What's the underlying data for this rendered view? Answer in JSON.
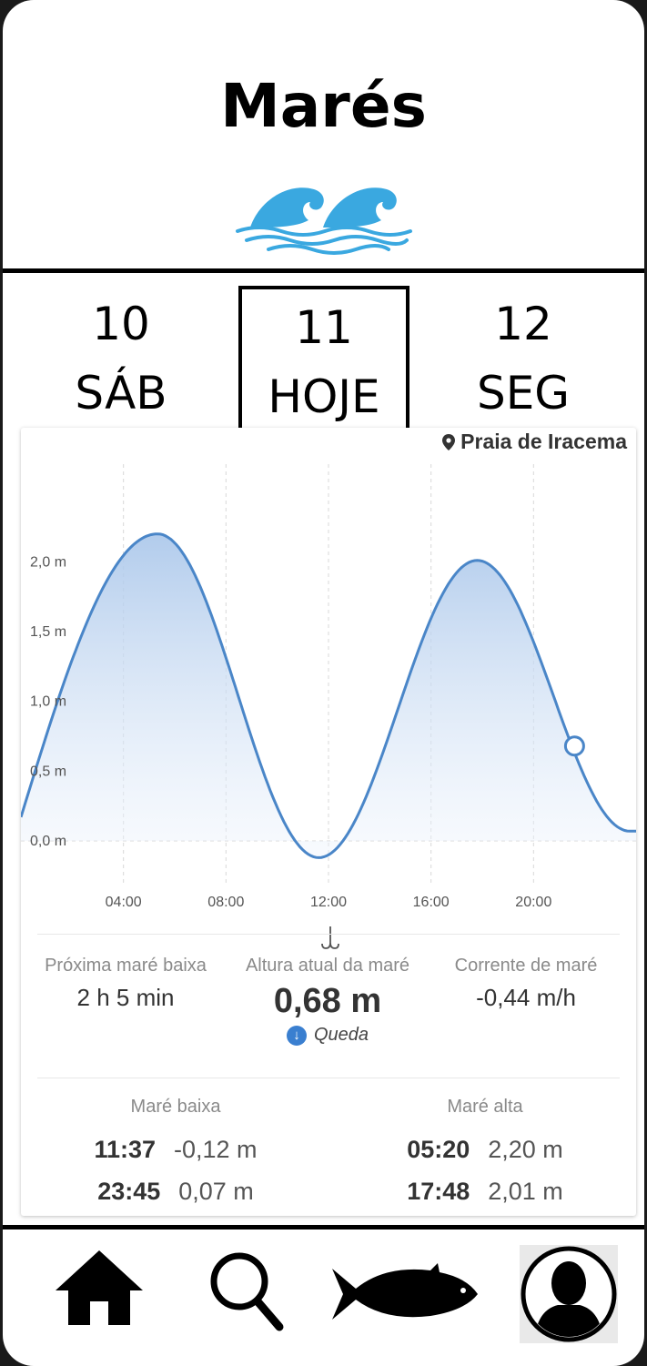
{
  "header": {
    "title": "Marés",
    "logo_icon": "waves-icon"
  },
  "days": [
    {
      "num": "10",
      "label": "SÁB",
      "selected": false
    },
    {
      "num": "11",
      "label": "HOJE",
      "selected": true
    },
    {
      "num": "12",
      "label": "SEG",
      "selected": false
    }
  ],
  "location": {
    "name": "Praia de Iracema",
    "icon": "map-pin-icon"
  },
  "chart_data": {
    "type": "area",
    "y_ticks": [
      "2,0 m",
      "1,5 m",
      "1,0 m",
      "0,5 m",
      "0,0 m"
    ],
    "y_tick_values": [
      2.0,
      1.5,
      1.0,
      0.5,
      0.0
    ],
    "x_ticks": [
      "04:00",
      "08:00",
      "12:00",
      "16:00",
      "20:00"
    ],
    "x_tick_values": [
      4,
      8,
      12,
      16,
      20
    ],
    "xlim": [
      0,
      24
    ],
    "ylim": [
      -0.3,
      2.7
    ],
    "grid": true,
    "series": [
      {
        "points": [
          {
            "x": 0.0,
            "y": 0.17
          },
          {
            "x": 5.33,
            "y": 2.2
          },
          {
            "x": 11.62,
            "y": -0.12
          },
          {
            "x": 17.8,
            "y": 2.01
          },
          {
            "x": 23.75,
            "y": 0.07
          }
        ]
      }
    ],
    "current_marker": {
      "x": 21.6,
      "y": 0.68
    },
    "accent_color": "#4a86c8"
  },
  "stats": {
    "next_low": {
      "label": "Próxima maré baixa",
      "value": "2 h 5 min"
    },
    "current": {
      "label": "Altura atual da maré",
      "value": "0,68 m",
      "trend": "Queda"
    },
    "current_flow": {
      "label": "Corrente de maré",
      "value": "-0,44 m/h"
    }
  },
  "tides": {
    "low": {
      "label": "Maré baixa",
      "rows": [
        {
          "time": "11:37",
          "height": "-0,12 m"
        },
        {
          "time": "23:45",
          "height": "0,07 m"
        }
      ]
    },
    "high": {
      "label": "Maré alta",
      "rows": [
        {
          "time": "05:20",
          "height": "2,20 m"
        },
        {
          "time": "17:48",
          "height": "2,01 m"
        }
      ]
    }
  },
  "nav": {
    "items": [
      {
        "icon": "home-icon"
      },
      {
        "icon": "search-icon"
      },
      {
        "icon": "fish-icon"
      },
      {
        "icon": "profile-avatar-icon"
      }
    ]
  }
}
